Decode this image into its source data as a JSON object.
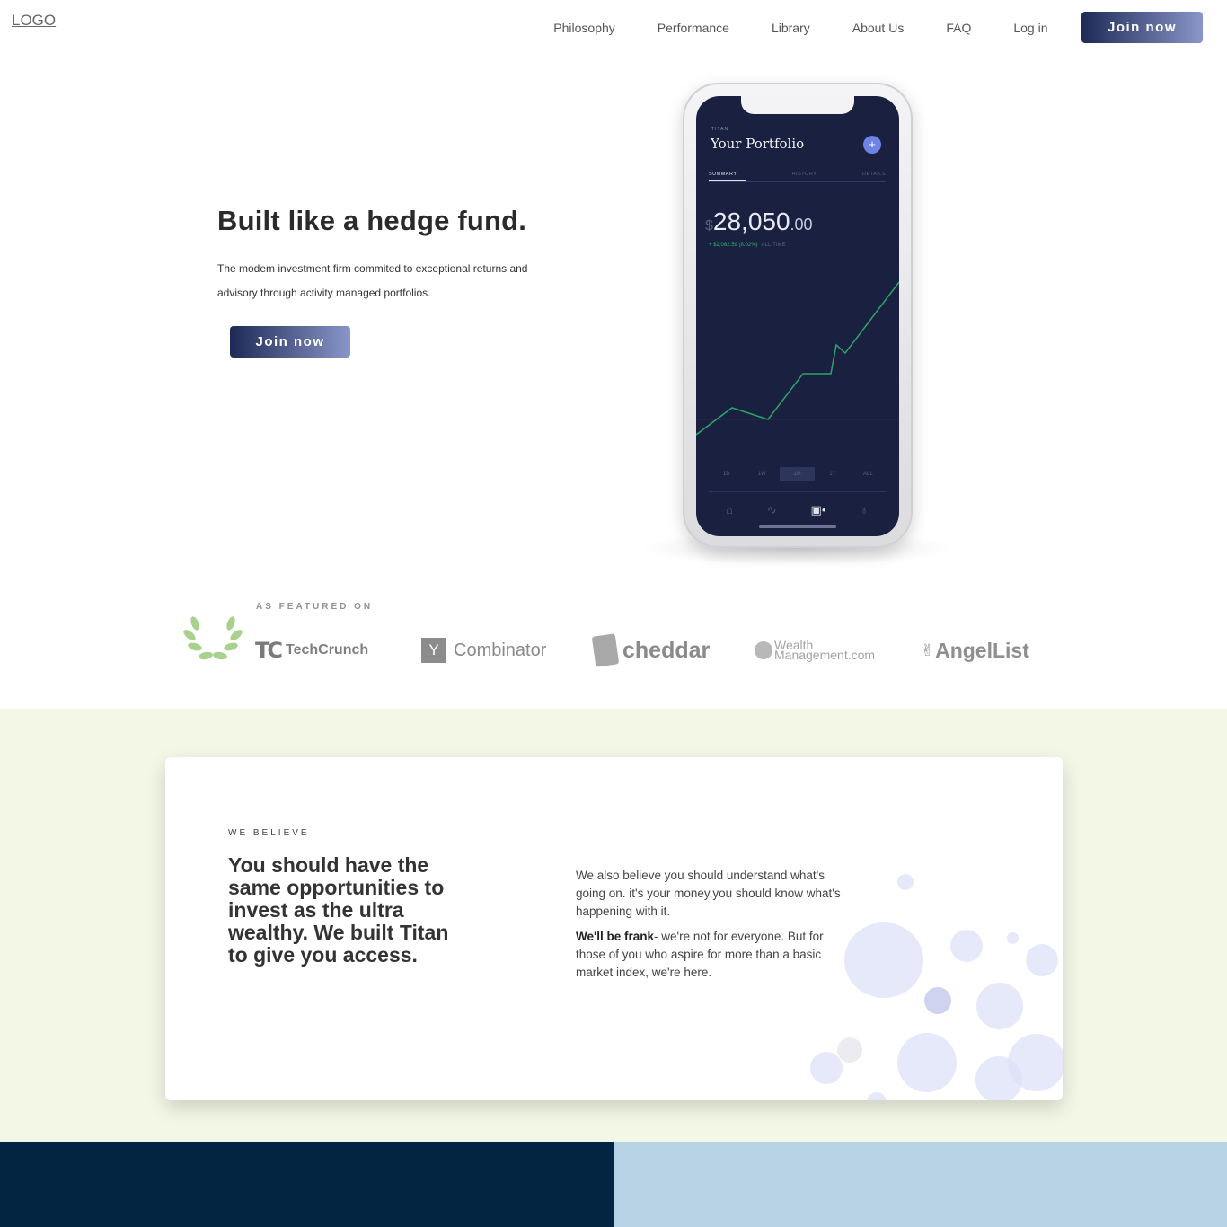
{
  "header": {
    "logo": "LOGO",
    "nav": [
      "Philosophy",
      "Performance",
      "Library",
      "About Us",
      "FAQ",
      "Log in"
    ],
    "cta": "Join now"
  },
  "hero": {
    "title": "Built like a hedge fund.",
    "text": "The modem investment firm commited to exceptional returns and advisory through activity managed portfolios.",
    "cta": "Join now"
  },
  "phone": {
    "brand": "TITAN",
    "title": "Your Portfolio",
    "tabs": [
      "SUMMARY",
      "HISTORY",
      "DETAILS"
    ],
    "value_currency": "$",
    "value_main": "28,050",
    "value_decimal": ".00",
    "change": "+ $2,082.59 (8.02%)",
    "change_label": "ALL-TIME",
    "ranges": [
      "1D",
      "1W",
      "1M",
      "1Y",
      "ALL"
    ],
    "active_range": "1M"
  },
  "featured": {
    "label": "AS FEATURED ON",
    "logos": {
      "techcrunch": "TechCrunch",
      "yc_letter": "Y",
      "yc": "Combinator",
      "cheddar": "cheddar",
      "wm_line1": "Wealth",
      "wm_line2": "Management.com",
      "angellist": "AngelList"
    }
  },
  "believe": {
    "label": "WE BELIEVE",
    "headline": "You should have the same opportunities to invest as the ultra wealthy. We built Titan to give you access.",
    "p1": "We also believe you should understand what's going on. it's your money,you should know what's happening with it.",
    "p2_bold": "We'll be frank",
    "p2_rest": "- we're not for everyone. But for those of you who aspire for more than a basic market index, we're here."
  },
  "colors": {
    "accent_dark": "#1e2a55",
    "accent_light": "#8a95c9",
    "chart_line": "#2fa36b",
    "band_bg": "#f3f7e6",
    "navy": "#032542",
    "sky": "#b6d2e4"
  }
}
